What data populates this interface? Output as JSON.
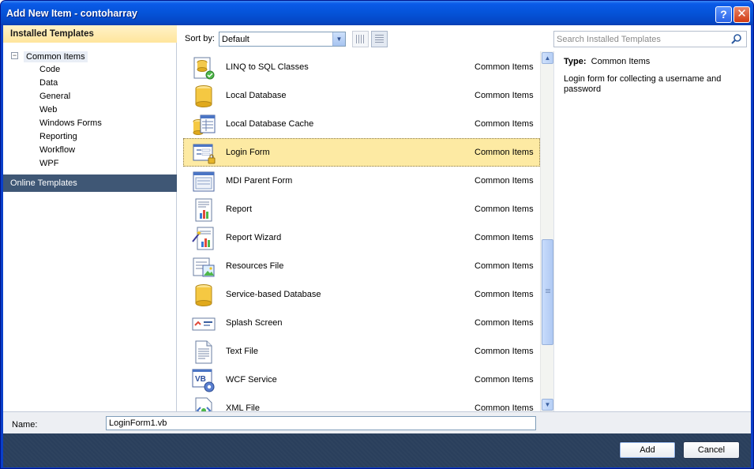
{
  "window": {
    "title": "Add New Item - contoharray",
    "help_glyph": "?",
    "close_glyph": "✕"
  },
  "left_panel": {
    "installed_header": "Installed Templates",
    "tree_root": "Common Items",
    "tree_children": [
      "Code",
      "Data",
      "General",
      "Web",
      "Windows Forms",
      "Reporting",
      "Workflow",
      "WPF"
    ],
    "online_header": "Online Templates"
  },
  "toolbar": {
    "sort_label": "Sort by:",
    "sort_value": "Default",
    "search_placeholder": "Search Installed Templates"
  },
  "items": [
    {
      "name": "LINQ to SQL Classes",
      "category": "Common Items",
      "icon": "linq-to-sql-icon"
    },
    {
      "name": "Local Database",
      "category": "Common Items",
      "icon": "database-icon"
    },
    {
      "name": "Local Database Cache",
      "category": "Common Items",
      "icon": "database-cache-icon"
    },
    {
      "name": "Login Form",
      "category": "Common Items",
      "icon": "login-form-icon"
    },
    {
      "name": "MDI Parent Form",
      "category": "Common Items",
      "icon": "mdi-form-icon"
    },
    {
      "name": "Report",
      "category": "Common Items",
      "icon": "report-icon"
    },
    {
      "name": "Report Wizard",
      "category": "Common Items",
      "icon": "report-wizard-icon"
    },
    {
      "name": "Resources File",
      "category": "Common Items",
      "icon": "resources-file-icon"
    },
    {
      "name": "Service-based Database",
      "category": "Common Items",
      "icon": "database-icon"
    },
    {
      "name": "Splash Screen",
      "category": "Common Items",
      "icon": "splash-screen-icon"
    },
    {
      "name": "Text File",
      "category": "Common Items",
      "icon": "text-file-icon"
    },
    {
      "name": "WCF Service",
      "category": "Common Items",
      "icon": "wcf-service-icon"
    },
    {
      "name": "XML File",
      "category": "Common Items",
      "icon": "xml-file-icon"
    }
  ],
  "selected_item": "Login Form",
  "description": {
    "type_label": "Type:",
    "type_value": "Common Items",
    "text": "Login form for collecting a username and password"
  },
  "name_field": {
    "label": "Name:",
    "value": "LoginForm1.vb"
  },
  "buttons": {
    "add": "Add",
    "cancel": "Cancel"
  },
  "colors": {
    "title_bar": "#0553d8",
    "installed_header": "#ffe59c",
    "online_header": "#3f5775",
    "selection": "#fdeaa3",
    "button_bar": "#2a3f5c"
  }
}
